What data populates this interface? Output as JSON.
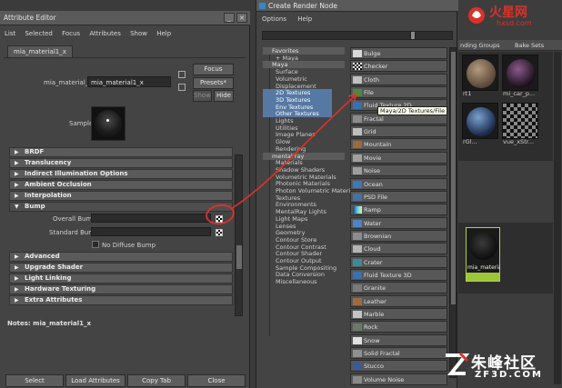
{
  "attribute_editor": {
    "title": "Attribute Editor",
    "menu": [
      "List",
      "Selected",
      "Focus",
      "Attributes",
      "Show",
      "Help"
    ],
    "node_tab": "mia_material1_x",
    "node_label": "mia_material_x:",
    "node_name": "mia_material1_x",
    "focus_label": "Focus",
    "presets_label": "Presets*",
    "show_label": "Show",
    "hide_label": "Hide",
    "sample_label": "Sample",
    "sections": [
      {
        "label": "BRDF",
        "arrow": "▶"
      },
      {
        "label": "Translucency",
        "arrow": "▶"
      },
      {
        "label": "Indirect Illumination Options",
        "arrow": "▶"
      },
      {
        "label": "Ambient Occlusion",
        "arrow": "▶"
      },
      {
        "label": "Interpolation",
        "arrow": "▶"
      },
      {
        "label": "Bump",
        "arrow": "▼"
      }
    ],
    "bump": {
      "overall_label": "Overall Bump",
      "standard_label": "Standard Bump",
      "no_diffuse_label": "No Diffuse Bump"
    },
    "sections_after": [
      {
        "label": "Advanced",
        "arrow": "▶"
      },
      {
        "label": "Upgrade Shader",
        "arrow": "▶"
      },
      {
        "label": "Light Linking",
        "arrow": "▶"
      },
      {
        "label": "Hardware Texturing",
        "arrow": "▶"
      },
      {
        "label": "Extra Attributes",
        "arrow": "▶"
      }
    ],
    "notes_label": "Notes:  mia_material1_x",
    "buttons": {
      "select": "Select",
      "load": "Load Attributes",
      "copy": "Copy Tab",
      "close": "Close"
    }
  },
  "create_render_node": {
    "title": "Create Render Node",
    "menu": [
      "Options",
      "Help"
    ],
    "tree": [
      {
        "label": "Favorites",
        "type": "hdr"
      },
      {
        "label": "+ Maya",
        "type": "item"
      },
      {
        "label": "Maya",
        "type": "hdr"
      },
      {
        "label": "Surface",
        "type": "item"
      },
      {
        "label": "Volumetric",
        "type": "item"
      },
      {
        "label": "Displacement",
        "type": "item"
      },
      {
        "label": "2D Textures",
        "type": "sel"
      },
      {
        "label": "3D Textures",
        "type": "sel"
      },
      {
        "label": "Env Textures",
        "type": "sel"
      },
      {
        "label": "Other Textures",
        "type": "sel"
      },
      {
        "label": "Lights",
        "type": "item"
      },
      {
        "label": "Utilities",
        "type": "item"
      },
      {
        "label": "Image Planes",
        "type": "item"
      },
      {
        "label": "Glow",
        "type": "item"
      },
      {
        "label": "Rendering",
        "type": "item"
      },
      {
        "label": "mental ray",
        "type": "hdr"
      },
      {
        "label": "Materials",
        "type": "item"
      },
      {
        "label": "Shadow Shaders",
        "type": "item"
      },
      {
        "label": "Volumetric Materials",
        "type": "item"
      },
      {
        "label": "Photonic Materials",
        "type": "item"
      },
      {
        "label": "Photon Volumetric Materi...",
        "type": "item"
      },
      {
        "label": "Textures",
        "type": "item"
      },
      {
        "label": "Environments",
        "type": "item"
      },
      {
        "label": "MentalRay Lights",
        "type": "item"
      },
      {
        "label": "Light Maps",
        "type": "item"
      },
      {
        "label": "Lenses",
        "type": "item"
      },
      {
        "label": "Geometry",
        "type": "item"
      },
      {
        "label": "Contour Store",
        "type": "item"
      },
      {
        "label": "Contour Contrast",
        "type": "item"
      },
      {
        "label": "Contour Shader",
        "type": "item"
      },
      {
        "label": "Contour Output",
        "type": "item"
      },
      {
        "label": "Sample Compositing",
        "type": "item"
      },
      {
        "label": "Data Conversion",
        "type": "item"
      },
      {
        "label": "Miscellaneous",
        "type": "item"
      }
    ],
    "nodes": [
      {
        "label": "Bulge",
        "icon": "bulge-icon",
        "color": "#d8d8d8"
      },
      {
        "label": "Checker",
        "icon": "checker-icon",
        "color": "#ffffff"
      },
      {
        "label": "Cloth",
        "icon": "cloth-icon",
        "color": "#c0c0c0"
      },
      {
        "label": "File",
        "icon": "file-icon",
        "color": "#4a8a3a"
      },
      {
        "label": "Fluid Texture 2D",
        "icon": "fluid-texture-2d-icon",
        "color": "#3a6fb0"
      },
      {
        "label": "Fractal",
        "icon": "fractal-icon",
        "color": "#8a8a8a"
      },
      {
        "label": "Grid",
        "icon": "grid-icon",
        "color": "#bfbfbf"
      },
      {
        "label": "Mountain",
        "icon": "mountain-icon",
        "color": "#9a6a3a"
      },
      {
        "label": "Movie",
        "icon": "movie-icon",
        "color": "#a0a0a0"
      },
      {
        "label": "Noise",
        "icon": "noise-icon",
        "color": "#9e9e9e"
      },
      {
        "label": "Ocean",
        "icon": "ocean-icon",
        "color": "#3a7ab8"
      },
      {
        "label": "PSD File",
        "icon": "psd-file-icon",
        "color": "#4a6fa0"
      },
      {
        "label": "Ramp",
        "icon": "ramp-icon",
        "color": "#55b0d0"
      },
      {
        "label": "Water",
        "icon": "water-icon",
        "color": "#4c84c4"
      },
      {
        "label": "Brownian",
        "icon": "brownian-icon",
        "color": "#8c8c8c"
      },
      {
        "label": "Cloud",
        "icon": "cloud-icon",
        "color": "#b4b4b4"
      },
      {
        "label": "Crater",
        "icon": "crater-icon",
        "color": "#3a8a9a"
      },
      {
        "label": "Fluid Texture 3D",
        "icon": "fluid-texture-3d-icon",
        "color": "#3a6fb0"
      },
      {
        "label": "Granite",
        "icon": "granite-icon",
        "color": "#7a7a7a"
      },
      {
        "label": "Leather",
        "icon": "leather-icon",
        "color": "#a06a40"
      },
      {
        "label": "Marble",
        "icon": "marble-icon",
        "color": "#c4c4c4"
      },
      {
        "label": "Rock",
        "icon": "rock-icon",
        "color": "#6a7a6a"
      },
      {
        "label": "Snow",
        "icon": "snow-icon",
        "color": "#e0e0e0"
      },
      {
        "label": "Solid Fractal",
        "icon": "solid-fractal-icon",
        "color": "#909090"
      },
      {
        "label": "Stucco",
        "icon": "stucco-icon",
        "color": "#3a5aa0"
      },
      {
        "label": "Volume Noise",
        "icon": "volume-noise-icon",
        "color": "#8a8a8a"
      }
    ],
    "tooltip": "Maya/2D Textures/File"
  },
  "hypershade": {
    "tab_left": "nding Groups",
    "tab_right": "Bake Sets",
    "swatches": [
      {
        "caption": "rt1",
        "ball": "#6a5a4a"
      },
      {
        "caption": "mi_car_p...",
        "ball": "#2a1a2a"
      },
      {
        "caption": "rGl...",
        "ball": "#2a4a7a"
      },
      {
        "caption": "vue_xStr...",
        "ball": "checker"
      }
    ],
    "selected_caption": "mia_material1_x"
  },
  "watermarks": {
    "top_text": "火星网",
    "top_sub": "hxsd.com",
    "bottom_text": "朱峰社区",
    "bottom_sub": "ZF3D.COM"
  },
  "colors": {
    "annotation_red": "#e0302a",
    "selection_blue": "#5679a4",
    "panel": "#444444"
  }
}
